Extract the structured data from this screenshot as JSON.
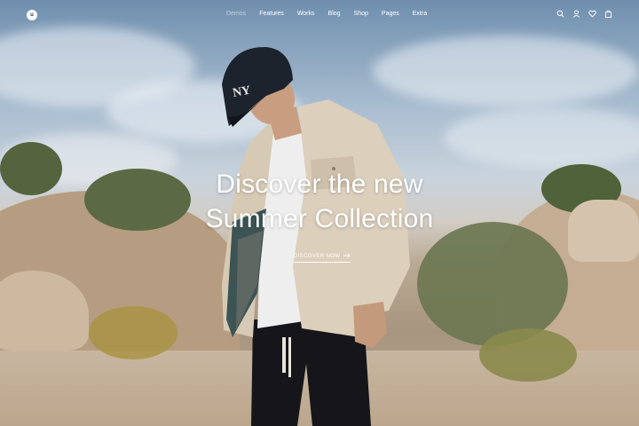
{
  "nav": {
    "logo_letter": "u",
    "items": [
      {
        "label": "Demos",
        "active": true
      },
      {
        "label": "Features",
        "active": false
      },
      {
        "label": "Works",
        "active": false
      },
      {
        "label": "Blog",
        "active": false
      },
      {
        "label": "Shop",
        "active": false
      },
      {
        "label": "Pages",
        "active": false
      },
      {
        "label": "Extra",
        "active": false
      }
    ],
    "icons": [
      "search-icon",
      "user-icon",
      "heart-icon",
      "bag-icon"
    ]
  },
  "hero": {
    "headline_line1": "Discover the new",
    "headline_line2": "Summer Collection",
    "cta_label": "DISCOVER NOW",
    "cta_icon": "arrow-right-icon"
  },
  "colors": {
    "text": "#ffffff",
    "active_nav": "#ffffff8c"
  }
}
